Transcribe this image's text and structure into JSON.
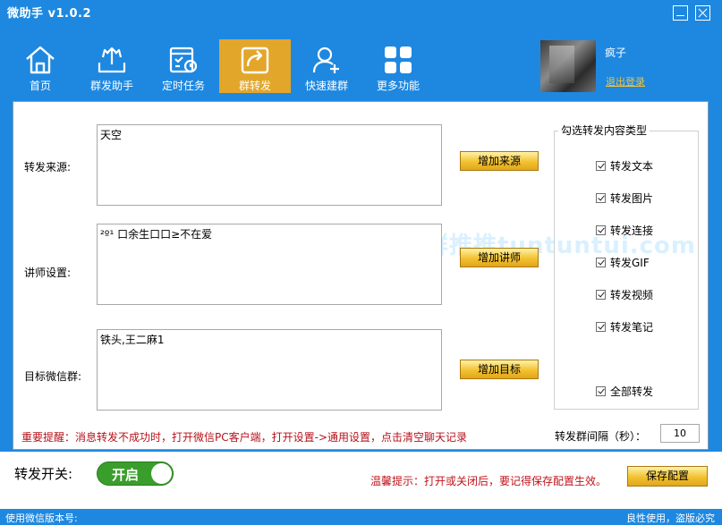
{
  "app": {
    "title": "微助手 v1.0.2"
  },
  "nav": [
    {
      "label": "首页",
      "icon": "home-icon"
    },
    {
      "label": "群发助手",
      "icon": "broadcast-icon"
    },
    {
      "label": "定时任务",
      "icon": "schedule-icon"
    },
    {
      "label": "群转发",
      "icon": "share-icon",
      "active": true
    },
    {
      "label": "快速建群",
      "icon": "add-user-icon"
    },
    {
      "label": "更多功能",
      "icon": "grid-icon"
    }
  ],
  "user": {
    "name": "疯子",
    "logout": "退出登录"
  },
  "form": {
    "source_label": "转发来源:",
    "source_value": "天空",
    "add_source": "增加来源",
    "lecturer_label": "讲师设置:",
    "lecturer_value": "²º¹ 口余生口口≥不在爱",
    "add_lecturer": "增加讲师",
    "target_label": "目标微信群:",
    "target_value": "铁头,王二麻1",
    "add_target": "增加目标"
  },
  "types": {
    "title": "勾选转发内容类型",
    "items": [
      "转发文本",
      "转发图片",
      "转发连接",
      "转发GIF",
      "转发视频",
      "转发笔记"
    ],
    "all": "全部转发"
  },
  "notice": "重要提醒：消息转发不成功时，打开微信PC客户端，打开设置->通用设置，点击清空聊天记录",
  "interval": {
    "label": "转发群间隔（秒）：",
    "value": "10"
  },
  "watermark": "群推推tuntuntui.com",
  "bottom": {
    "switch_label": "转发开关:",
    "switch_state": "开启",
    "hint": "温馨提示：打开或关闭后，要记得保存配置生效。",
    "save": "保存配置"
  },
  "status": {
    "left": "使用微信版本号:",
    "right": "良性使用，盗版必究"
  },
  "colors": {
    "header": "#1e88e0",
    "active_tab": "#e2a62b",
    "button": "#f2c230",
    "toggle": "#3a9e2c",
    "alert": "#c0141c"
  }
}
